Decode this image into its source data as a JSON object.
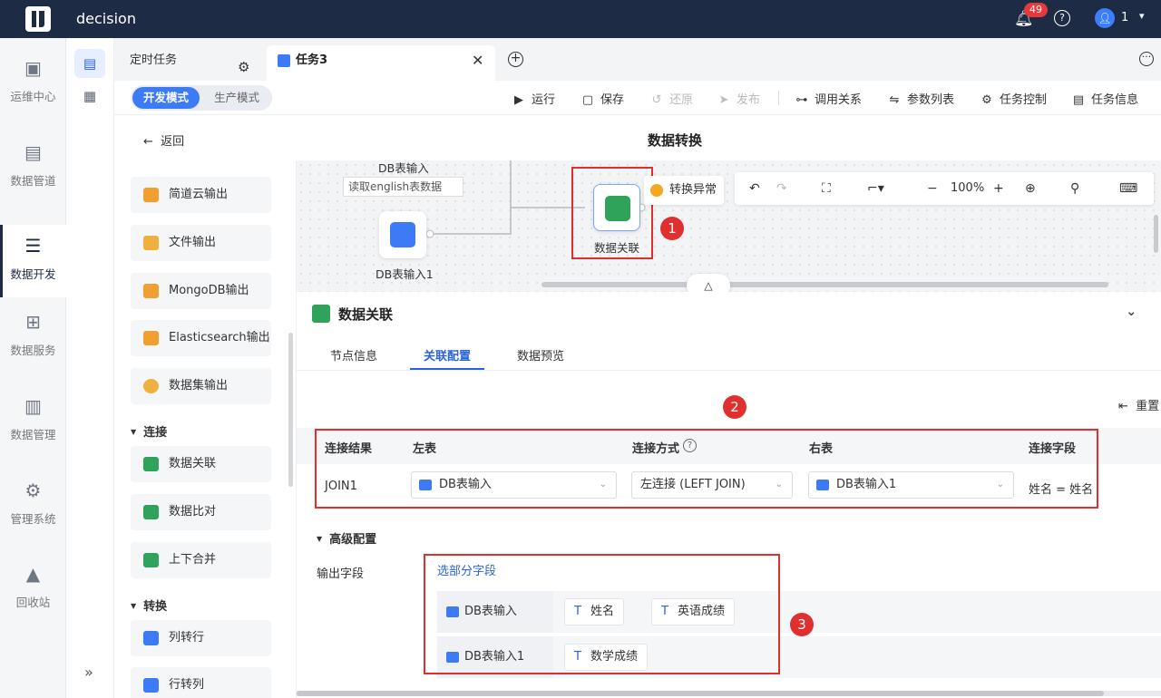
{
  "app": {
    "name": "decision",
    "notifications": "49",
    "user": "1"
  },
  "nav": [
    {
      "label": "运维中心",
      "icon": "clipboard-check-icon"
    },
    {
      "label": "数据管道",
      "icon": "pipeline-icon"
    },
    {
      "label": "数据开发",
      "icon": "dev-stack-icon"
    },
    {
      "label": "数据服务",
      "icon": "service-icon"
    },
    {
      "label": "数据管理",
      "icon": "manage-icon"
    },
    {
      "label": "管理系统",
      "icon": "gear-icon"
    },
    {
      "label": "回收站",
      "icon": "recycle-icon"
    }
  ],
  "tabs": {
    "tab1": "定时任务",
    "tab2": "任务3"
  },
  "modes": {
    "dev": "开发模式",
    "prod": "生产模式"
  },
  "toolbar": {
    "run": "运行",
    "save": "保存",
    "restore": "还原",
    "publish": "发布",
    "relation": "调用关系",
    "params": "参数列表",
    "control": "任务控制",
    "info": "任务信息"
  },
  "subhead": {
    "back": "返回",
    "title": "数据转换"
  },
  "palette": {
    "items_top": [
      "简道云输出",
      "文件输出",
      "MongoDB输出",
      "Elasticsearch输出",
      "数据集输出"
    ],
    "group_connect": "连接",
    "items_connect": [
      "数据关联",
      "数据比对",
      "上下合并"
    ],
    "group_transform": "转换",
    "items_transform": [
      "列转行",
      "行转列"
    ]
  },
  "canvas": {
    "node_db1_title": "DB表输入",
    "node_db1_desc": "读取english表数据",
    "node_db2_label": "DB表输入1",
    "node_join_label": "数据关联",
    "warning": "转换异常",
    "zoom": "100%",
    "marker1": "1"
  },
  "panel": {
    "title": "数据关联",
    "tabs": [
      "节点信息",
      "关联配置",
      "数据预览"
    ],
    "reset": "重置",
    "marker2": "2",
    "marker3": "3",
    "join_headers": [
      "连接结果",
      "左表",
      "连接方式",
      "右表",
      "连接字段"
    ],
    "join_row": {
      "result": "JOIN1",
      "left": "DB表输入",
      "method": "左连接 (LEFT JOIN)",
      "right": "DB表输入1",
      "fields": "姓名 = 姓名"
    },
    "advanced": "高级配置",
    "output_label": "输出字段",
    "select_partial": "选部分字段",
    "field_rows": [
      {
        "source": "DB表输入",
        "fields": [
          "姓名",
          "英语成绩"
        ]
      },
      {
        "source": "DB表输入1",
        "fields": [
          "数学成绩"
        ]
      }
    ]
  }
}
